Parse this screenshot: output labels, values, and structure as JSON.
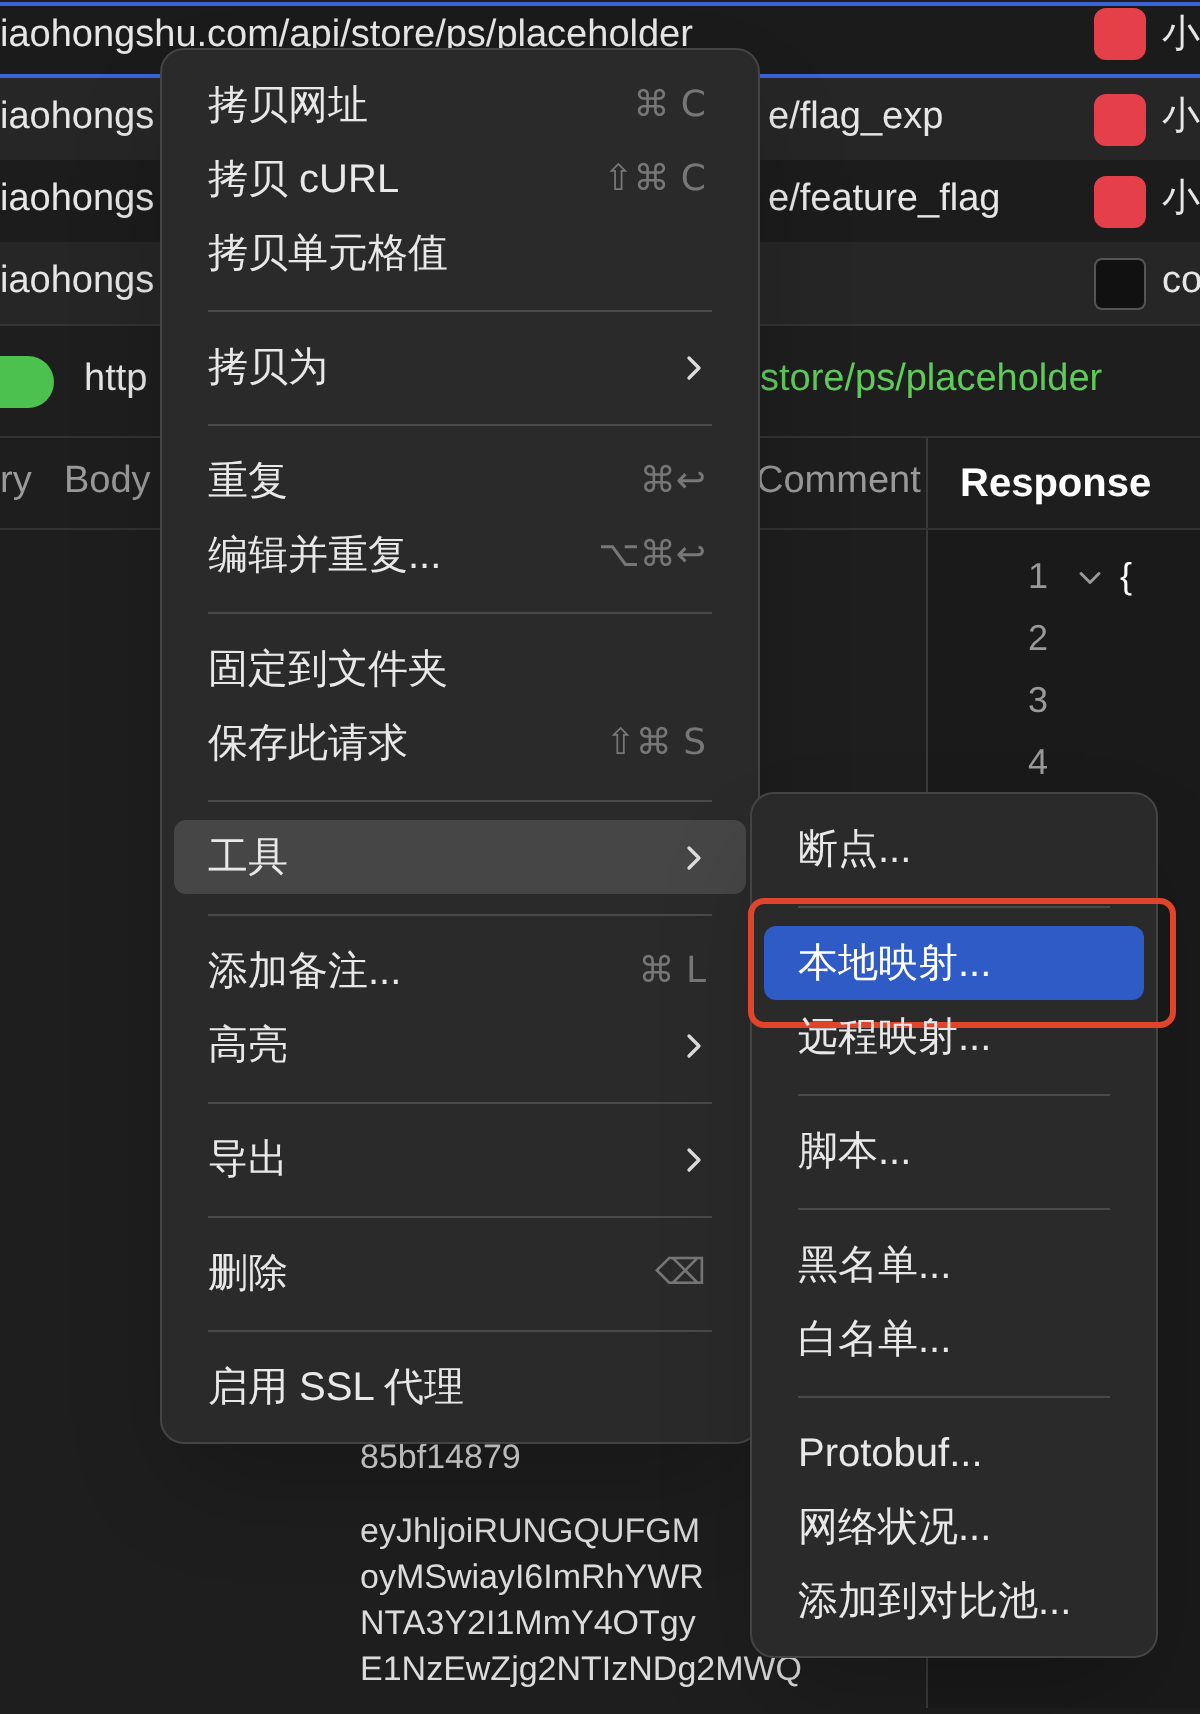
{
  "request_rows": [
    {
      "url_start": "iaohongshu.com/api/store/ps/placeholder",
      "url_end": "",
      "app": "小",
      "kind": "red",
      "selected": true
    },
    {
      "url_start": "iaohongs",
      "url_end": "e/flag_exp",
      "app": "小",
      "kind": "red",
      "selected": false
    },
    {
      "url_start": "iaohongs",
      "url_end": "e/feature_flag",
      "app": "小",
      "kind": "red",
      "selected": false
    },
    {
      "url_start": "iaohongs",
      "url_end": "",
      "app": "co",
      "kind": "terminal",
      "selected": false
    }
  ],
  "url_bar": {
    "start": "http",
    "end": "store/ps/placeholder"
  },
  "request_tabs": [
    {
      "label": "ry",
      "selected": false
    },
    {
      "label": "Body",
      "selected": false
    },
    {
      "label": "Comment",
      "selected": false
    }
  ],
  "response": {
    "title": "Response",
    "line_numbers": [
      "1",
      "2",
      "3",
      "4"
    ],
    "first_line": "{"
  },
  "body_lines": [
    "85bf14879",
    "eyJhljoiRUNGQUFGM",
    "oyMSwiayI6ImRhYWR",
    "NTA3Y2I1MmY4OTgy",
    "E1NzEwZjg2NTIzNDg2MWQ"
  ],
  "context_menu": [
    [
      {
        "label": "拷贝网址",
        "shortcut": "⌘ C",
        "submenu": false,
        "selected": false
      },
      {
        "label": "拷贝 cURL",
        "shortcut": "⇧⌘ C",
        "submenu": false,
        "selected": false
      },
      {
        "label": "拷贝单元格值",
        "submenu": false,
        "selected": false
      }
    ],
    [
      {
        "label": "拷贝为",
        "submenu": true,
        "selected": false
      }
    ],
    [
      {
        "label": "重复",
        "shortcut": "⌘↩",
        "submenu": false,
        "selected": false
      },
      {
        "label": "编辑并重复...",
        "shortcut": "⌥⌘↩",
        "submenu": false,
        "selected": false
      }
    ],
    [
      {
        "label": "固定到文件夹",
        "submenu": false,
        "selected": false
      },
      {
        "label": "保存此请求",
        "shortcut": "⇧⌘ S",
        "submenu": false,
        "selected": false
      }
    ],
    [
      {
        "label": "工具",
        "submenu": true,
        "selected": true
      }
    ],
    [
      {
        "label": "添加备注...",
        "shortcut": "⌘ L",
        "submenu": false,
        "selected": false
      },
      {
        "label": "高亮",
        "submenu": true,
        "selected": false
      }
    ],
    [
      {
        "label": "导出",
        "submenu": true,
        "selected": false
      }
    ],
    [
      {
        "label": "删除",
        "shortcut": "⌫",
        "submenu": false,
        "selected": false
      }
    ],
    [
      {
        "label": "启用 SSL 代理",
        "submenu": false,
        "selected": false
      }
    ]
  ],
  "tools_submenu": [
    [
      {
        "label": "断点...",
        "selected": false,
        "annotated": false
      }
    ],
    [
      {
        "label": "本地映射...",
        "selected": true,
        "annotated": true
      },
      {
        "label": "远程映射...",
        "selected": false,
        "annotated": false
      }
    ],
    [
      {
        "label": "脚本...",
        "selected": false,
        "annotated": false
      }
    ],
    [
      {
        "label": "黑名单...",
        "selected": false,
        "annotated": false
      },
      {
        "label": "白名单...",
        "selected": false,
        "annotated": false
      }
    ],
    [
      {
        "label": "Protobuf...",
        "selected": false,
        "annotated": false
      },
      {
        "label": "网络状况...",
        "selected": false,
        "annotated": false
      },
      {
        "label": "添加到对比池...",
        "selected": false,
        "annotated": false
      }
    ]
  ]
}
